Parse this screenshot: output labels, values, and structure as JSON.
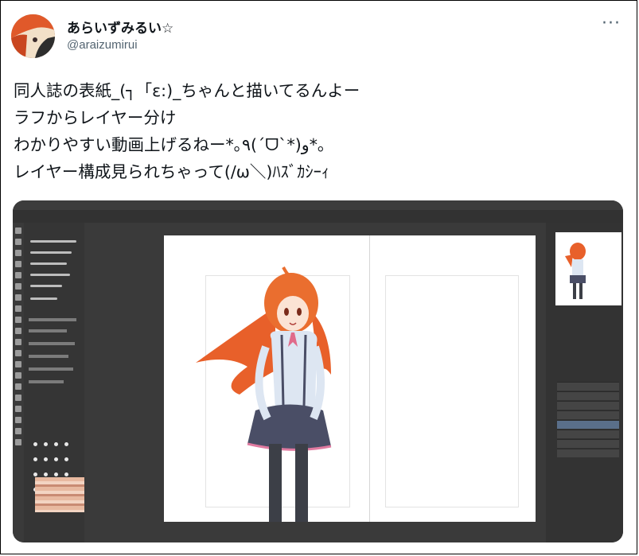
{
  "post": {
    "display_name": "あらいずみるい☆",
    "handle": "@araizumirui",
    "more_label": "···",
    "text_lines": [
      "同人誌の表紙_(┐「ε:)_ちゃんと描いてるんよー",
      "ラフからレイヤー分け",
      "わかりやすい動画上げるねー*｡٩(ˊᗜˋ*)و*｡",
      "レイヤー構成見られちゃって(/ω＼)ﾊｽﾞｶｼｰｨ"
    ]
  },
  "media": {
    "icon": "illustration-software-screenshot",
    "description_icon": "anime-girl-illustration-icon"
  },
  "colors": {
    "text": "#0f1419",
    "secondary": "#536471",
    "hair": "#e86a2c",
    "app_bg": "#2b2b2b"
  }
}
